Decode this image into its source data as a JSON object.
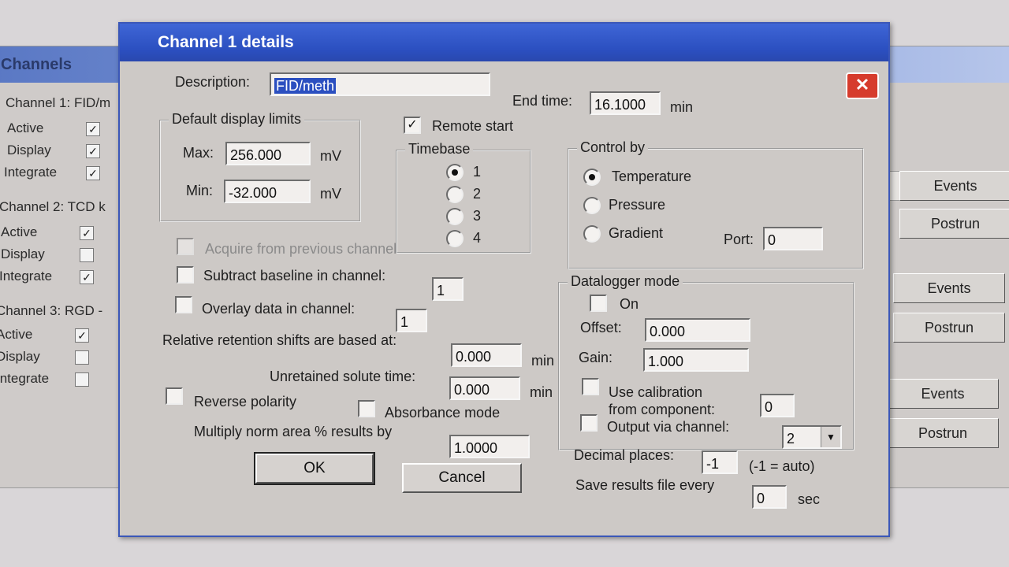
{
  "background_window": {
    "title": "Channels",
    "channels": [
      {
        "heading": "Channel 1: FID/m",
        "rows": [
          {
            "label": "Active",
            "checked": true
          },
          {
            "label": "Display",
            "checked": true
          },
          {
            "label": "Integrate",
            "checked": true
          }
        ]
      },
      {
        "heading": "Channel 2: TCD k",
        "rows": [
          {
            "label": "Active",
            "checked": true
          },
          {
            "label": "Display",
            "checked": false
          },
          {
            "label": "Integrate",
            "checked": true
          }
        ]
      },
      {
        "heading": "Channel 3: RGD -",
        "rows": [
          {
            "label": "Active",
            "checked": true
          },
          {
            "label": "Display",
            "checked": false
          },
          {
            "label": "Integrate",
            "checked": false
          }
        ]
      }
    ],
    "buttons": {
      "events": "Events",
      "postrun": "Postrun"
    }
  },
  "dialog": {
    "title": "Channel 1 details",
    "close_glyph": "✕",
    "description_label": "Description:",
    "description_value": "FID/meth",
    "end_time_label": "End time:",
    "end_time_value": "16.1000",
    "end_time_unit": "min",
    "display_limits": {
      "title": "Default display limits",
      "max_label": "Max:",
      "max_value": "256.000",
      "max_unit": "mV",
      "min_label": "Min:",
      "min_value": "-32.000",
      "min_unit": "mV"
    },
    "remote_start_label": "Remote start",
    "remote_start_checked": true,
    "timebase": {
      "title": "Timebase",
      "options": [
        "1",
        "2",
        "3",
        "4"
      ],
      "selected": "1"
    },
    "control_by": {
      "title": "Control by",
      "options": [
        "Temperature",
        "Pressure",
        "Gradient"
      ],
      "selected": "Temperature",
      "port_label": "Port:",
      "port_value": "0"
    },
    "acquire_prev_label": "Acquire from previous channel",
    "subtract_baseline_label": "Subtract baseline in channel:",
    "subtract_baseline_value": "1",
    "overlay_label": "Overlay data in channel:",
    "overlay_value": "1",
    "rel_retention_label": "Relative retention shifts are based at:",
    "rel_retention_value": "0.000",
    "rel_retention_unit": "min",
    "unretained_label": "Unretained solute time:",
    "unretained_value": "0.000",
    "unretained_unit": "min",
    "reverse_polarity_label": "Reverse polarity",
    "absorbance_label": "Absorbance mode",
    "multiply_label": "Multiply norm area % results by",
    "multiply_value": "1.0000",
    "ok_label": "OK",
    "cancel_label": "Cancel",
    "datalogger": {
      "title": "Datalogger mode",
      "on_label": "On",
      "offset_label": "Offset:",
      "offset_value": "0.000",
      "gain_label": "Gain:",
      "gain_value": "1.000",
      "use_calib_label_1": "Use calibration",
      "use_calib_label_2": "from component:",
      "use_calib_value": "0",
      "output_label": "Output via channel:",
      "output_value": "2"
    },
    "decimal_label": "Decimal places:",
    "decimal_value": "-1",
    "decimal_note": "(-1 = auto)",
    "save_label": "Save results file every",
    "save_value": "0",
    "save_unit": "sec"
  }
}
